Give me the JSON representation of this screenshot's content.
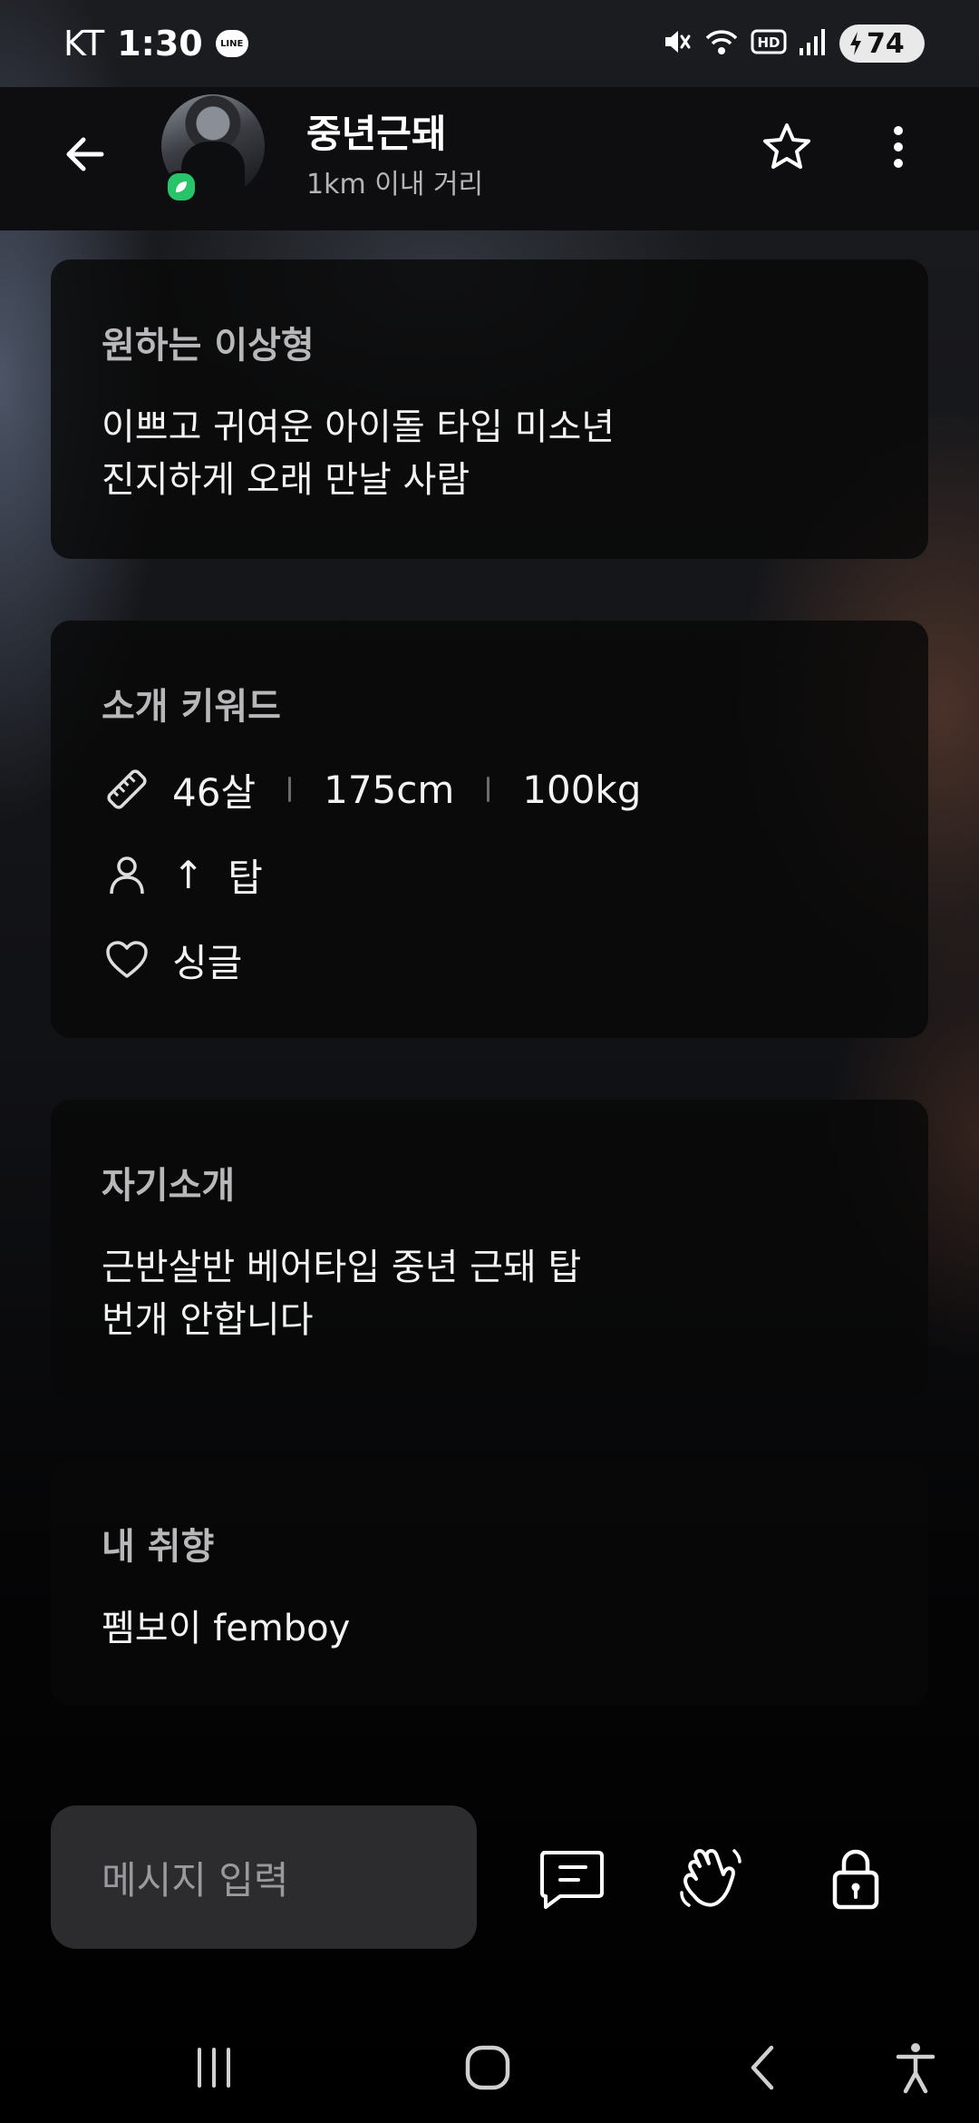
{
  "status_bar": {
    "carrier": "KT",
    "time": "1:30",
    "line_badge": "LINE",
    "battery_level": "74",
    "icons": [
      "line-icon",
      "mute-icon",
      "wifi-icon",
      "hd-icon",
      "signal-icon",
      "battery-charging-icon"
    ]
  },
  "header": {
    "profile_name": "중년근돼",
    "distance": "1km 이내 거리"
  },
  "cards": {
    "ideal_type": {
      "title": "원하는 이상형",
      "line1": "이쁘고 귀여운 아이돌 타입 미소년",
      "line2": "진지하게 오래 만날 사람"
    },
    "keywords": {
      "title": "소개 키워드",
      "age": "46살",
      "height": "175cm",
      "weight": "100kg",
      "position_arrow": "↑",
      "position": "탑",
      "relationship": "싱글"
    },
    "self_intro": {
      "title": "자기소개",
      "line1": "근반살반 베어타입 중년 근돼 탑",
      "line2": "번개 안합니다"
    },
    "preference": {
      "title": "내 취향",
      "text": "펨보이 femboy"
    }
  },
  "bottom_bar": {
    "message_placeholder": "메시지 입력"
  },
  "colors": {
    "background": "#0b0b0c",
    "card": "#080809",
    "card_title": "#b8b8bb",
    "input_bg": "#2c2c2e",
    "online_badge": "#27c46a"
  }
}
